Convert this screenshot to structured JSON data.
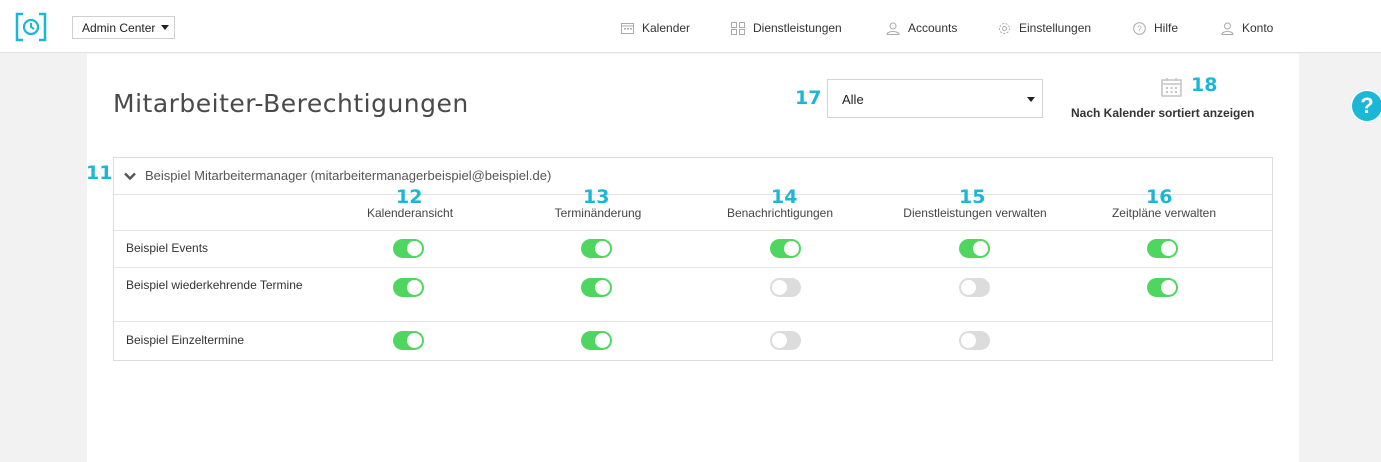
{
  "topbar": {
    "admin_select": "Admin Center",
    "nav": {
      "kalender": "Kalender",
      "dienstleistungen": "Dienstleistungen",
      "accounts": "Accounts",
      "einstellungen": "Einstellungen",
      "hilfe": "Hilfe",
      "konto": "Konto"
    }
  },
  "page": {
    "title": "Mitarbeiter-Berechtigungen",
    "filter_value": "Alle",
    "sort_by_calendar_label": "Nach Kalender sortiert anzeigen"
  },
  "markers": {
    "m11": "11",
    "m12": "12",
    "m13": "13",
    "m14": "14",
    "m15": "15",
    "m16": "16",
    "m17": "17",
    "m18": "18"
  },
  "panel": {
    "header": "Beispiel Mitarbeitermanager (mitarbeitermanagerbeispiel@beispiel.de)",
    "columns": [
      "Kalenderansicht",
      "Terminänderung",
      "Benachrichtigungen",
      "Dienstleistungen verwalten",
      "Zeitpläne verwalten"
    ],
    "rows": [
      {
        "label": "Beispiel Events",
        "toggles": [
          true,
          true,
          true,
          true,
          true
        ]
      },
      {
        "label": "Beispiel wiederkehrende Termine",
        "toggles": [
          true,
          true,
          false,
          false,
          true
        ]
      },
      {
        "label": "Beispiel Einzeltermine",
        "toggles": [
          true,
          true,
          false,
          false,
          null
        ]
      }
    ]
  },
  "colors": {
    "accent": "#1ab7d6",
    "toggle_on": "#4fd660",
    "toggle_off": "#dcdcdc"
  },
  "icons": {
    "logo": "clock-bracket-icon",
    "help_float": "question-circle-icon"
  }
}
